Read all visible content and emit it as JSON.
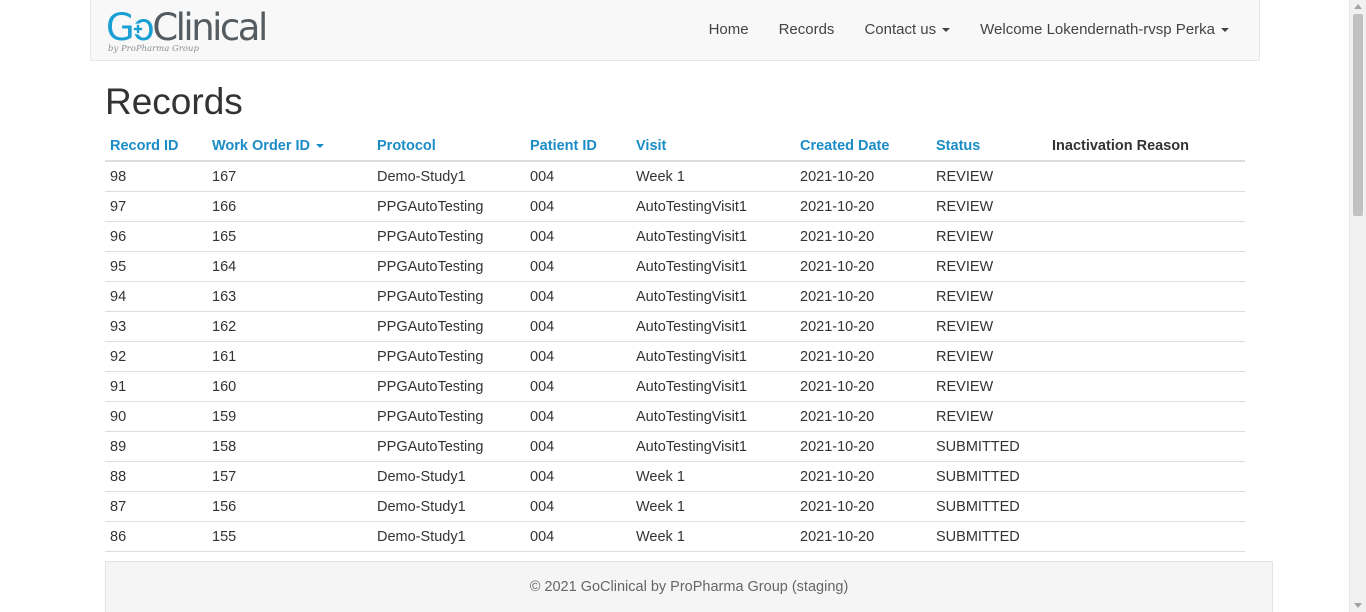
{
  "brand": {
    "go": "Go",
    "clinical": "Clinical",
    "tagline": "by ProPharma Group"
  },
  "nav": {
    "home": "Home",
    "records": "Records",
    "contact": "Contact us",
    "user": "Welcome Lokendernath-rvsp Perka"
  },
  "page": {
    "title": "Records"
  },
  "table": {
    "columns": [
      "Record ID",
      "Work Order ID",
      "Protocol",
      "Patient ID",
      "Visit",
      "Created Date",
      "Status",
      "Inactivation Reason"
    ],
    "rows": [
      [
        "98",
        "167",
        "Demo-Study1",
        "004",
        "Week 1",
        "2021-10-20",
        "REVIEW",
        ""
      ],
      [
        "97",
        "166",
        "PPGAutoTesting",
        "004",
        "AutoTestingVisit1",
        "2021-10-20",
        "REVIEW",
        ""
      ],
      [
        "96",
        "165",
        "PPGAutoTesting",
        "004",
        "AutoTestingVisit1",
        "2021-10-20",
        "REVIEW",
        ""
      ],
      [
        "95",
        "164",
        "PPGAutoTesting",
        "004",
        "AutoTestingVisit1",
        "2021-10-20",
        "REVIEW",
        ""
      ],
      [
        "94",
        "163",
        "PPGAutoTesting",
        "004",
        "AutoTestingVisit1",
        "2021-10-20",
        "REVIEW",
        ""
      ],
      [
        "93",
        "162",
        "PPGAutoTesting",
        "004",
        "AutoTestingVisit1",
        "2021-10-20",
        "REVIEW",
        ""
      ],
      [
        "92",
        "161",
        "PPGAutoTesting",
        "004",
        "AutoTestingVisit1",
        "2021-10-20",
        "REVIEW",
        ""
      ],
      [
        "91",
        "160",
        "PPGAutoTesting",
        "004",
        "AutoTestingVisit1",
        "2021-10-20",
        "REVIEW",
        ""
      ],
      [
        "90",
        "159",
        "PPGAutoTesting",
        "004",
        "AutoTestingVisit1",
        "2021-10-20",
        "REVIEW",
        ""
      ],
      [
        "89",
        "158",
        "PPGAutoTesting",
        "004",
        "AutoTestingVisit1",
        "2021-10-20",
        "SUBMITTED",
        ""
      ],
      [
        "88",
        "157",
        "Demo-Study1",
        "004",
        "Week 1",
        "2021-10-20",
        "SUBMITTED",
        ""
      ],
      [
        "87",
        "156",
        "Demo-Study1",
        "004",
        "Week 1",
        "2021-10-20",
        "SUBMITTED",
        ""
      ],
      [
        "86",
        "155",
        "Demo-Study1",
        "004",
        "Week 1",
        "2021-10-20",
        "SUBMITTED",
        ""
      ]
    ]
  },
  "footer": {
    "text": "© 2021 GoClinical by ProPharma Group (staging)"
  },
  "colors": {
    "link": "#1a8cc6",
    "brand_blue": "#1a9fd4",
    "brand_gray": "#555c61"
  },
  "icons": {
    "sort": "caret-down-icon",
    "dropdown": "caret-down-icon",
    "logo_cross": "plus-icon"
  }
}
